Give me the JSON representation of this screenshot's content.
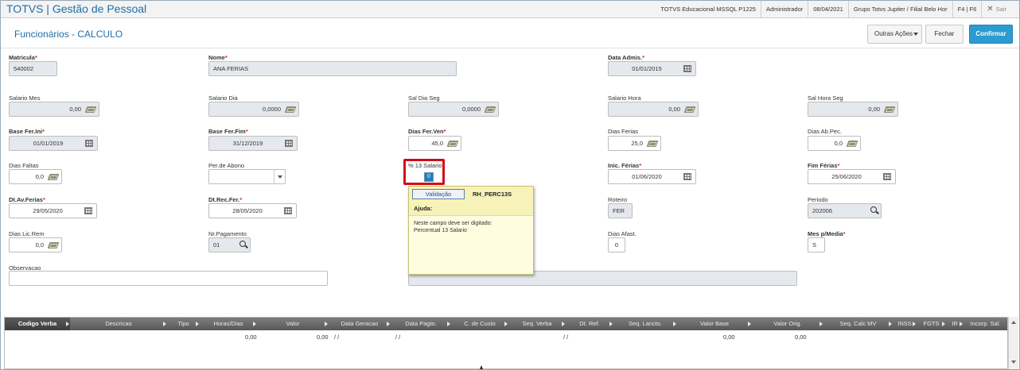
{
  "app": {
    "title": "TOTVS | Gestão de Pessoal"
  },
  "topbar": {
    "system": "TOTVS Educacional MSSQL P1225",
    "user": "Administrador",
    "date": "08/04/2021",
    "branch": "Grupo Totvs Jupiter / Filial Belo Hor",
    "shortcuts": "F4 | F6",
    "exit_label": "Sair"
  },
  "page": {
    "title": "Funcionários - CALCULO"
  },
  "actions": {
    "other": "Outras Ações",
    "close": "Fechar",
    "confirm": "Confirmar"
  },
  "form": {
    "matricula": {
      "label": "Matricula",
      "value": "540002"
    },
    "nome": {
      "label": "Nome",
      "value": "ANA FERIAS"
    },
    "data_admis": {
      "label": "Data Admis.",
      "value": "01/01/2015"
    },
    "salario_mes": {
      "label": "Salario Mes",
      "value": "0,00"
    },
    "salario_dia": {
      "label": "Salario Dia",
      "value": "0,0000"
    },
    "sal_dia_seg": {
      "label": "Sal Dia Seg",
      "value": "0,0000"
    },
    "salario_hora": {
      "label": "Salario Hora",
      "value": "0,00"
    },
    "sal_hora_seg": {
      "label": "Sal Hora Seg",
      "value": "0,00"
    },
    "base_fer_ini": {
      "label": "Base Fer.Ini",
      "value": "01/01/2019"
    },
    "base_fer_fim": {
      "label": "Base Fer.Fim",
      "value": "31/12/2019"
    },
    "dias_fer_ven": {
      "label": "Dias Fer.Ven",
      "value": "45,0"
    },
    "dias_ferias": {
      "label": "Dias Ferias",
      "value": "25,0"
    },
    "dias_ab_pec": {
      "label": "Dias Ab.Pec.",
      "value": "0,0"
    },
    "dias_faltas": {
      "label": "Dias Faltas",
      "value": "0,0"
    },
    "per_abono": {
      "label": "Per.de Abono",
      "value": ""
    },
    "perc_13": {
      "label": "% 13 Salario",
      "value": "0"
    },
    "inic_ferias": {
      "label": "Inic. Férias",
      "value": "01/06/2020"
    },
    "fim_ferias": {
      "label": "Fim Férias",
      "value": "25/06/2020"
    },
    "dt_av_ferias": {
      "label": "Dt.Av.Ferias",
      "value": "29/05/2020"
    },
    "dt_rec_fer": {
      "label": "Dt.Rec.Fer.",
      "value": "28/05/2020"
    },
    "roteiro": {
      "label": "Roteiro",
      "value": "FER"
    },
    "periodo": {
      "label": "Periodo",
      "value": "202006"
    },
    "dias_lic_rem": {
      "label": "Dias Lic.Rem",
      "value": "0,0"
    },
    "nr_pagamento": {
      "label": "Nr.Pagamento",
      "value": "01"
    },
    "dias_afast": {
      "label": "Dias Afast.",
      "value": "0"
    },
    "mes_p_media": {
      "label": "Mes p/Media",
      "value": "S"
    },
    "observacao": {
      "label": "Observacao",
      "value": ""
    }
  },
  "popup": {
    "validation_label": "Validação",
    "code": "RH_PERC13S",
    "help_title": "Ajuda:",
    "help_text": "Neste campo deve ser digitado:\nPercentual 13 Salario"
  },
  "grid": {
    "columns": [
      "Codigo Verba",
      "Descricao",
      "Tipo",
      "Horas/Dias",
      "Valor",
      "Data Geracao",
      "Data Pagto.",
      "C. de Custo",
      "Seq. Verba",
      "Dt. Ref.",
      "Seq. Lancto.",
      "Valor Base",
      "Valor Orig.",
      "Seq. Calc MV",
      "INSS",
      "FGTS",
      "IR",
      "Incorp. Sal."
    ],
    "row": {
      "horas_dias": "0,00",
      "valor": "0,00",
      "data_geracao": "/ /",
      "data_pagto": "/ /",
      "dt_ref": "/ /",
      "valor_base": "0,00",
      "valor_orig": "0,00"
    }
  },
  "icons": {
    "money": "cash-icon",
    "calendar": "calendar-icon",
    "search": "magnifier-icon",
    "close": "close-icon"
  }
}
